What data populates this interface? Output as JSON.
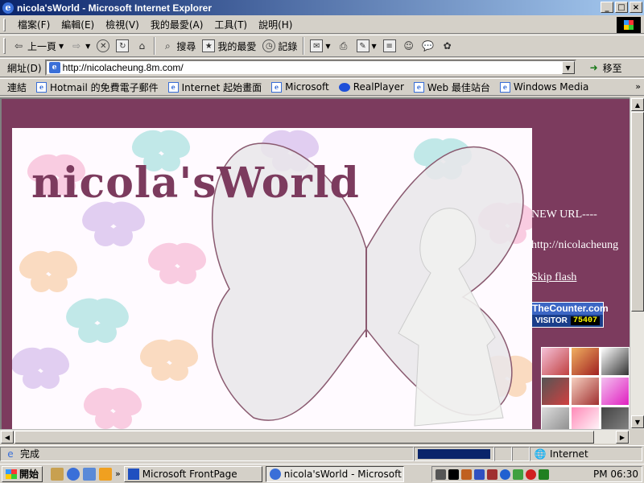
{
  "window": {
    "title": "nicola'sWorld - Microsoft Internet Explorer",
    "controls": {
      "minimize": "_",
      "maximize": "□",
      "close": "×"
    }
  },
  "menu": [
    "檔案(F)",
    "編輯(E)",
    "檢視(V)",
    "我的最愛(A)",
    "工具(T)",
    "說明(H)"
  ],
  "toolbar": {
    "back": "上一頁",
    "search": "搜尋",
    "favorites": "我的最愛",
    "history": "記錄"
  },
  "address": {
    "label": "網址(D)",
    "url": "http://nicolacheung.8m.com/",
    "go": "移至"
  },
  "links": {
    "label": "連結",
    "items": [
      "Hotmail 的免費電子郵件",
      "Internet 起始畫面",
      "Microsoft",
      "RealPlayer",
      "Web 最佳站台",
      "Windows Media"
    ],
    "more": "»"
  },
  "content": {
    "logo": "nicola'sWorld",
    "new_url_label": "NEW URL----",
    "new_url": "http://nicolacheung",
    "skip_flash": "Skip flash",
    "counter": {
      "brand": "TheCounter.com",
      "visitor_label": "VISITOR",
      "count": "75407"
    }
  },
  "status": {
    "text": "完成",
    "zone": "Internet"
  },
  "taskbar": {
    "start": "開始",
    "more": "»",
    "buttons": [
      "Microsoft FrontPage",
      "nicola'sWorld - Microsoft I..."
    ],
    "clock": "PM 06:30"
  },
  "colors": {
    "page_bg": "#7c3b5e",
    "title_gradient_start": "#0a246a",
    "title_gradient_end": "#a6caf0",
    "chrome": "#d4d0c8"
  }
}
